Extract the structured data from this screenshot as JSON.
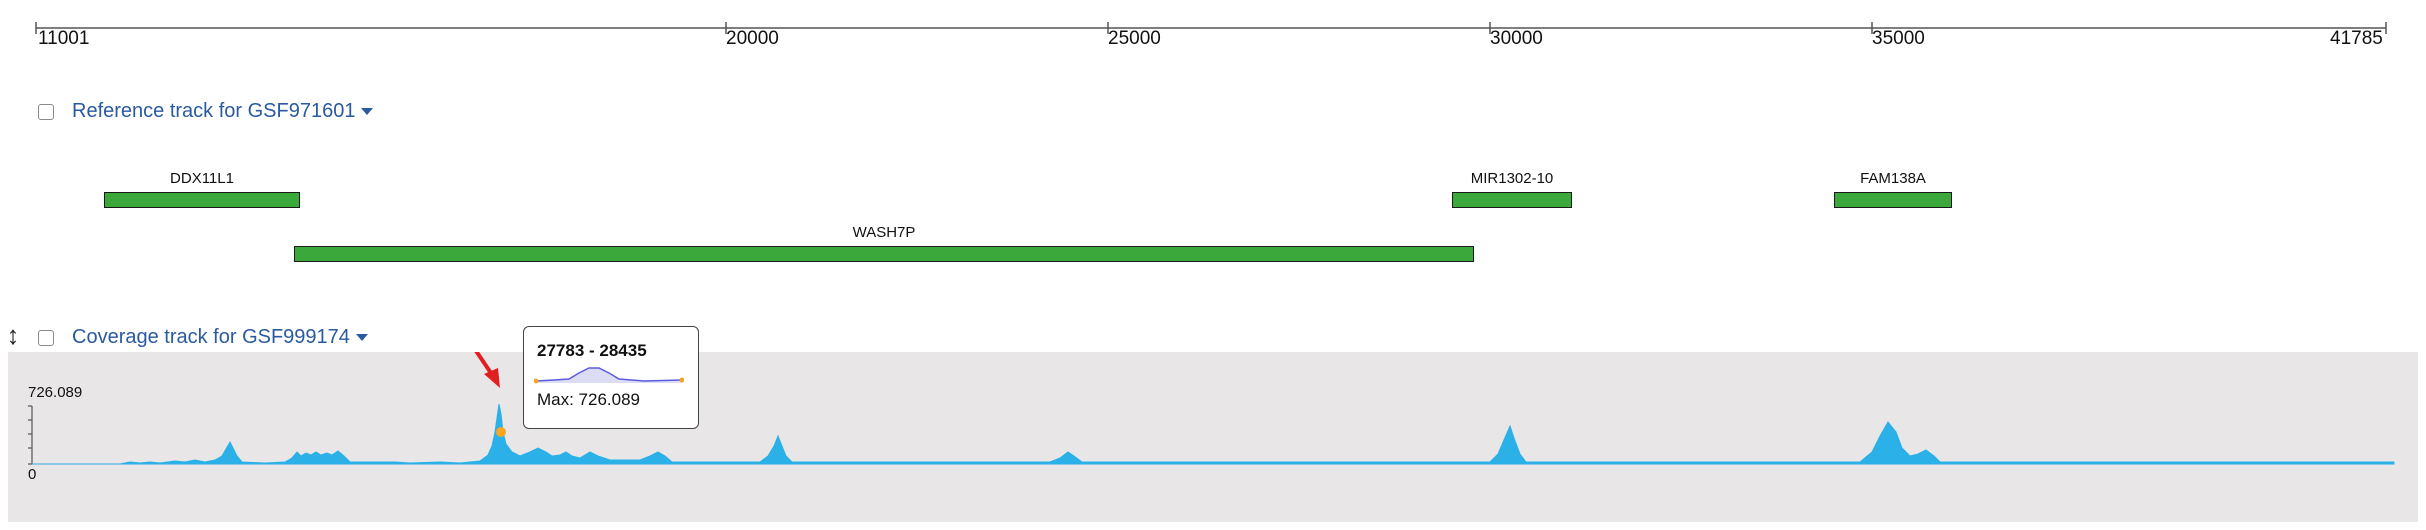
{
  "ruler": {
    "start_label": "11001",
    "end_label": "41785",
    "ticks": [
      "20000",
      "25000",
      "30000",
      "35000"
    ]
  },
  "reference_track": {
    "title": "Reference track for GSF971601",
    "checked": false,
    "genes": [
      {
        "name": "DDX11L1",
        "start": 11870,
        "end": 14410
      },
      {
        "name": "WASH7P",
        "start": 14360,
        "end": 29800
      },
      {
        "name": "MIR1302-10",
        "start": 29555,
        "end": 31110
      },
      {
        "name": "FAM138A",
        "start": 34555,
        "end": 36080
      }
    ]
  },
  "coverage_track": {
    "title": "Coverage track for GSF999174",
    "checked": false,
    "max_label": "726.089",
    "min_label": "0",
    "colors": {
      "fill": "#2bb0e8",
      "highlight": "#f5a623",
      "arrow": "#e02020"
    },
    "tooltip": {
      "range": "27783 - 28435",
      "max_text": "Max: 726.089"
    }
  }
}
